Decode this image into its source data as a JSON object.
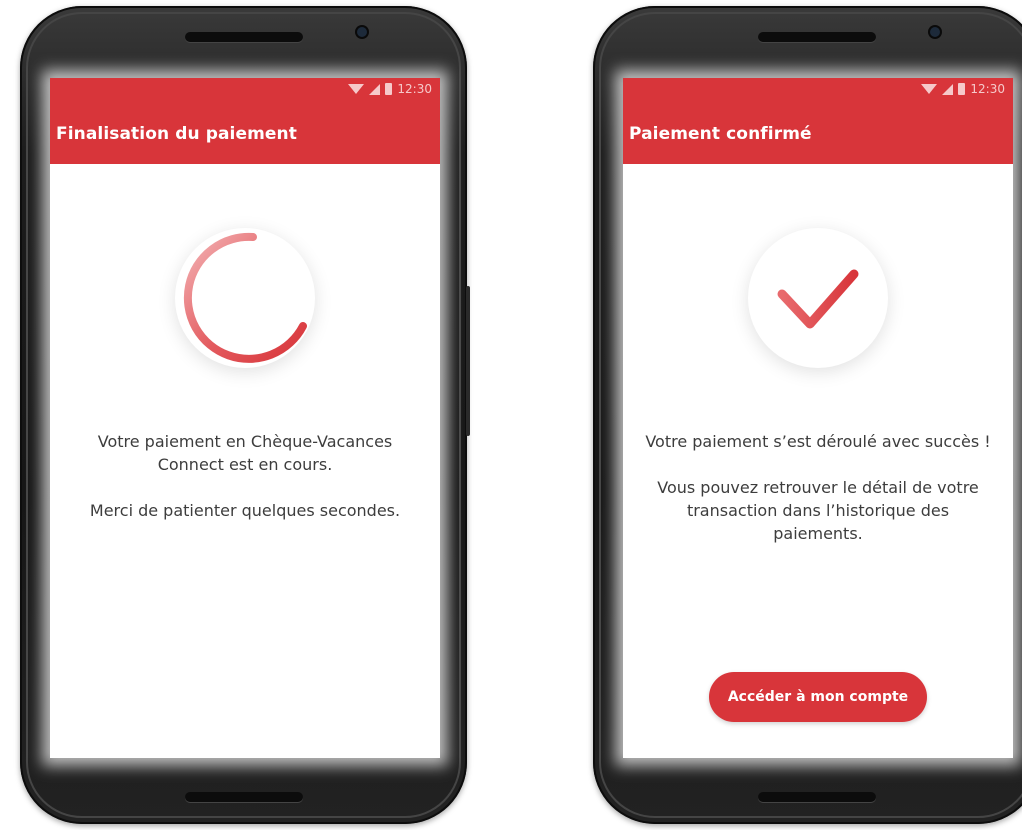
{
  "left_screen": {
    "status_time": "12:30",
    "title": "Finalisation du paiement",
    "message_1": "Votre paiement en Chèque-Vacances Connect est en cours.",
    "message_2": "Merci de patienter quelques secondes.",
    "icon": "loading-spinner-icon"
  },
  "right_screen": {
    "status_time": "12:30",
    "title": "Paiement confirmé",
    "message_1": "Votre paiement s’est déroulé avec succès !",
    "message_2": "Vous pouvez retrouver le détail de votre transaction dans l’historique des paiements.",
    "icon": "checkmark-icon",
    "button_label": "Accéder à mon compte"
  },
  "colors": {
    "accent": "#d8353a",
    "text": "#3d3d3d",
    "screen_bg": "#ffffff"
  }
}
